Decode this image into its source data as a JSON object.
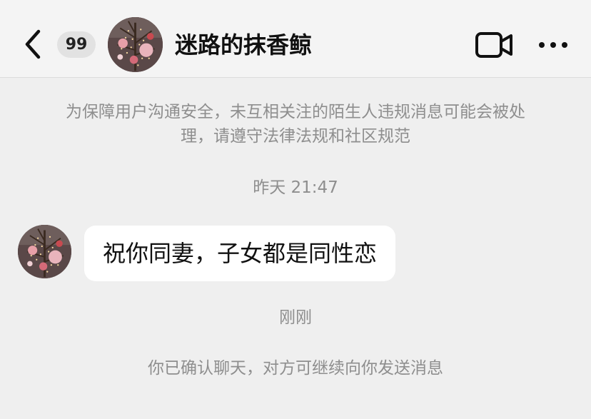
{
  "header": {
    "back_icon": "chevron-left-icon",
    "unread_count": "99",
    "contact_name": "迷路的抹香鲸",
    "video_icon": "video-camera-icon",
    "more_icon": "more-dots-icon"
  },
  "chat": {
    "safety_notice": "为保障用户沟通安全，未互相关注的陌生人违规消息可能会被处理，请遵守法律法规和社区规范",
    "timestamp_1": "昨天 21:47",
    "message_text": "祝你同妻，子女都是同性恋",
    "timestamp_2": "刚刚",
    "system_notice": "你已确认聊天，对方可继续向你发送消息"
  },
  "colors": {
    "background": "#efefef",
    "header_background": "#f4f4f4",
    "bubble": "#ffffff",
    "meta_text": "#8e8e8e"
  }
}
